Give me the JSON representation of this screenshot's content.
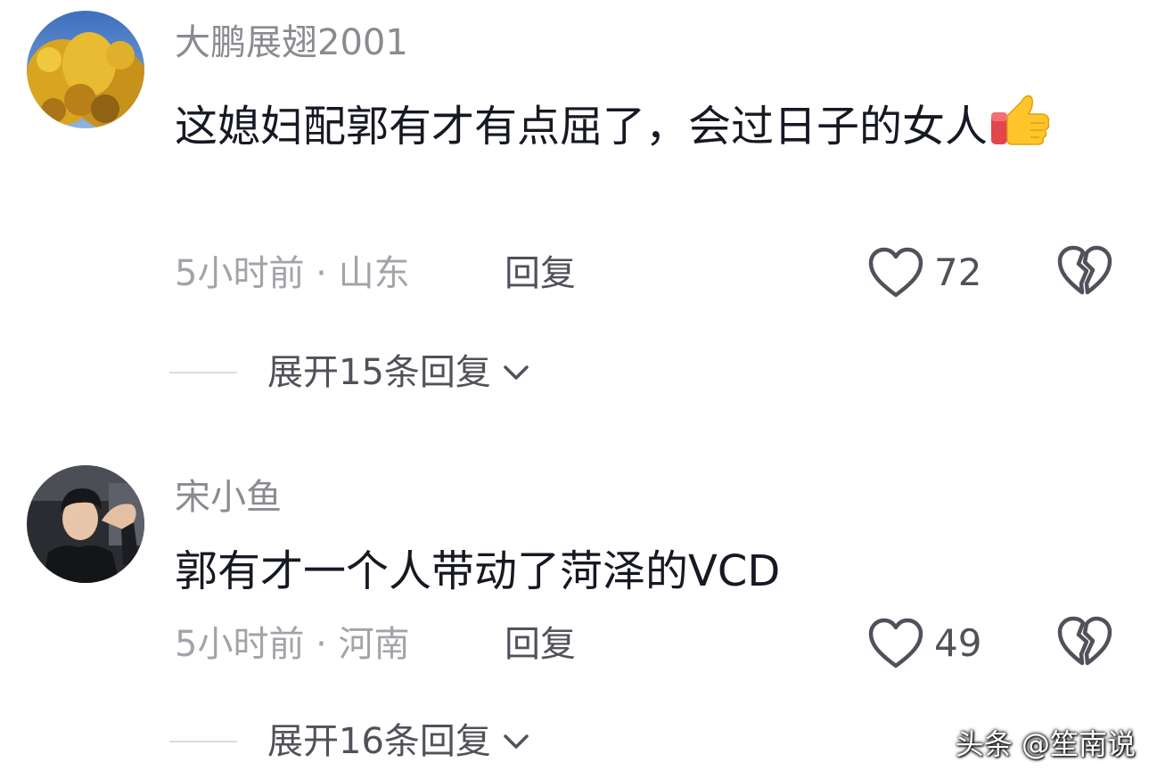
{
  "comments": [
    {
      "username": "大鹏展翅2001",
      "avatar_icon": "golden-tree-avatar",
      "content": "这媳妇配郭有才有点屈了，会过日子的女人",
      "content_emoji": "thumbs-up-emoji",
      "time_location": "5小时前 · 山东",
      "reply_label": "回复",
      "like_count": "72",
      "expand_label": "展开15条回复"
    },
    {
      "username": "宋小鱼",
      "avatar_icon": "person-photo-avatar",
      "content": "郭有才一个人带动了菏泽的VCD",
      "time_location": "5小时前 · 河南",
      "reply_label": "回复",
      "like_count": "49",
      "expand_label": "展开16条回复"
    }
  ],
  "watermark": "头条 @笙南说",
  "colors": {
    "text_primary": "#161823",
    "text_secondary": "#8a8b91",
    "text_meta": "#a3a4a9",
    "action_gray": "#50515a",
    "background": "#ffffff"
  }
}
